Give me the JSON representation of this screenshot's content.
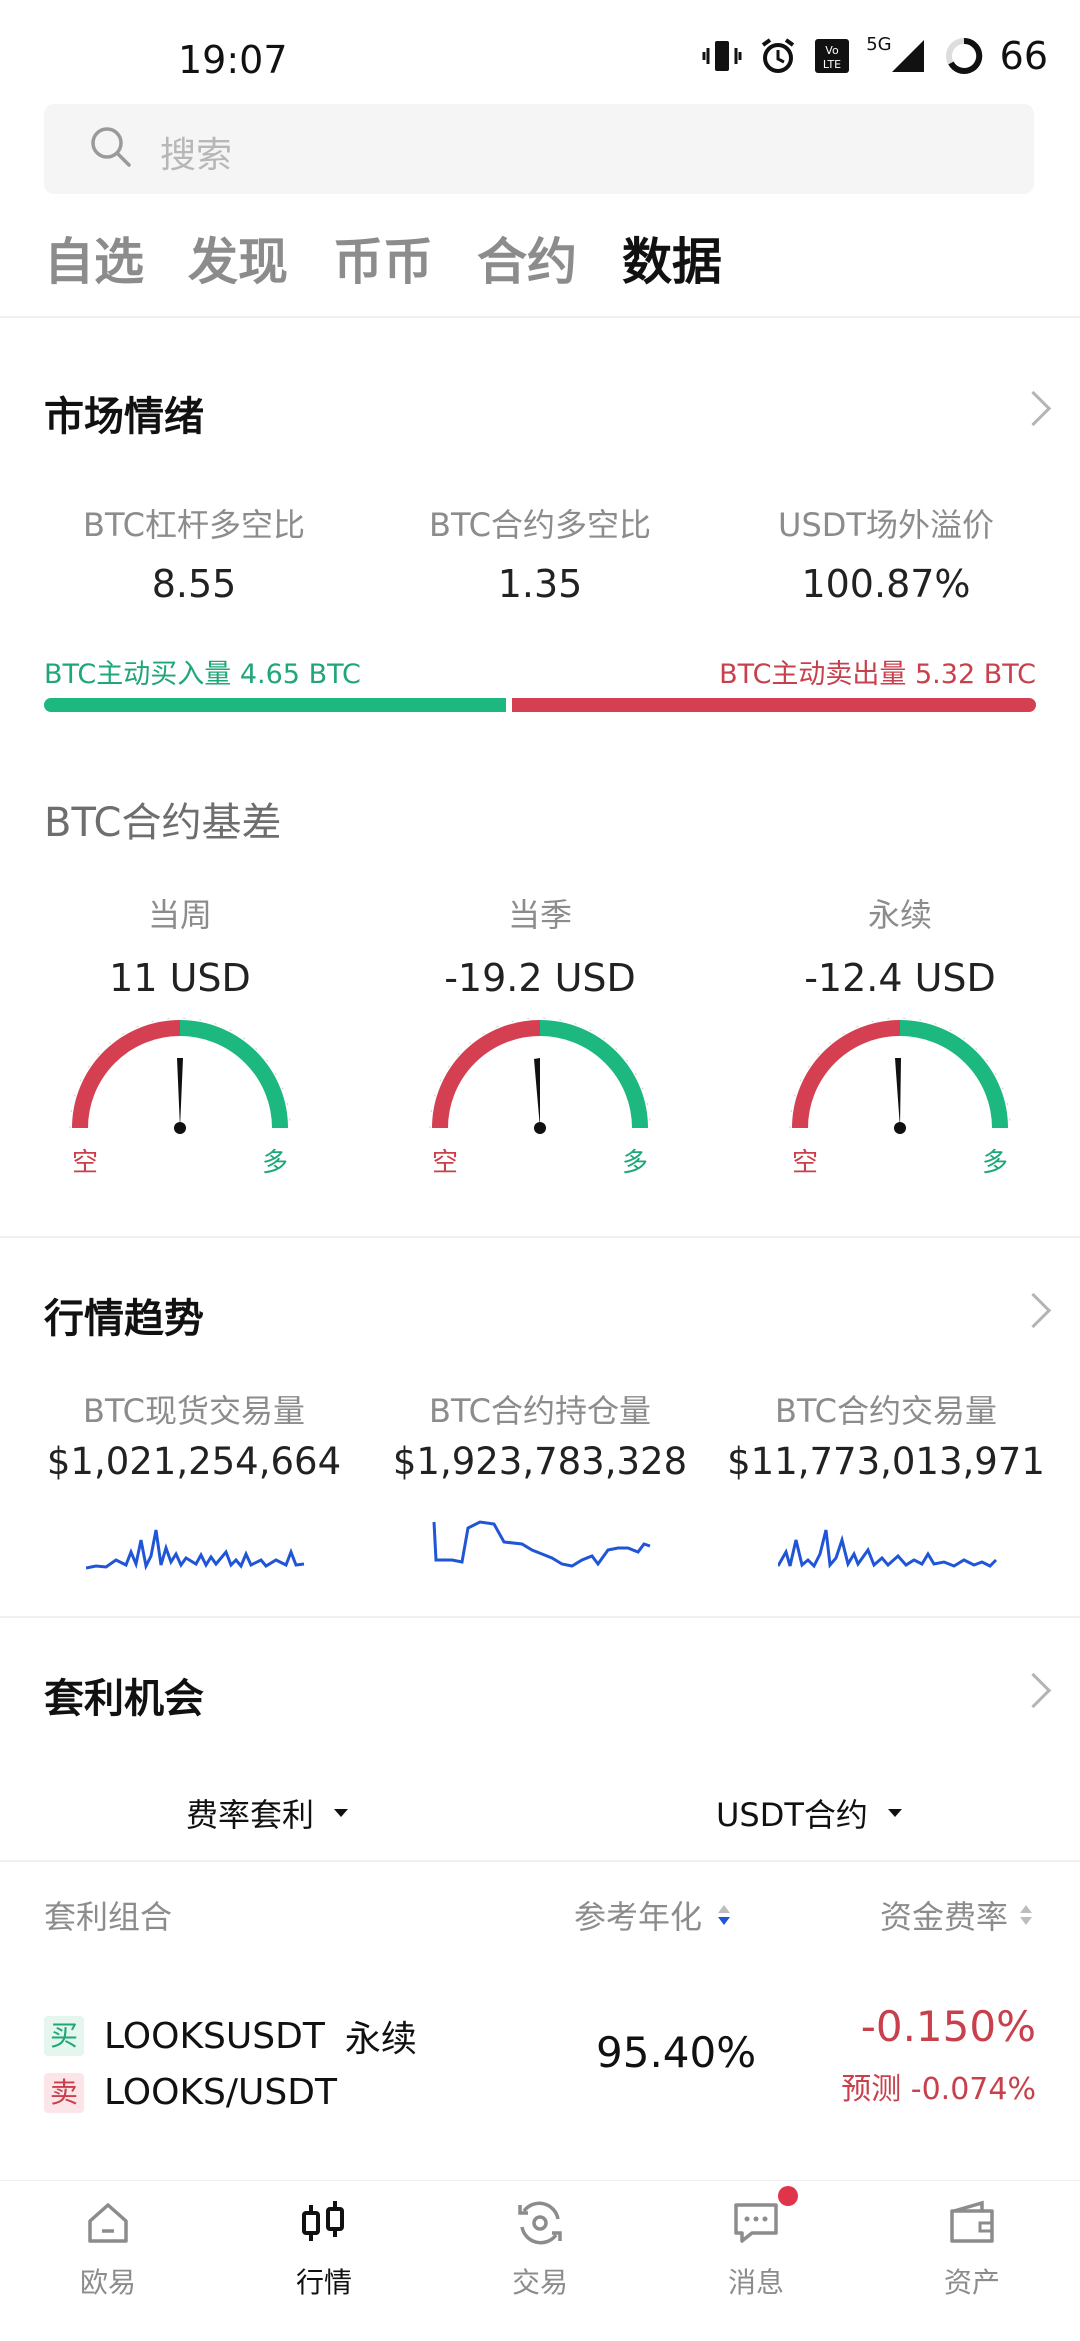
{
  "status": {
    "time": "19:07",
    "battery": "66",
    "network": "5G"
  },
  "search": {
    "placeholder": "搜索"
  },
  "tabs": [
    "自选",
    "发现",
    "币币",
    "合约",
    "数据"
  ],
  "sentiment": {
    "title": "市场情绪",
    "stats": [
      {
        "label": "BTC杠杆多空比",
        "value": "8.55"
      },
      {
        "label": "BTC合约多空比",
        "value": "1.35"
      },
      {
        "label": "USDT场外溢价",
        "value": "100.87%"
      }
    ],
    "buy_volume": "BTC主动买入量 4.65 BTC",
    "sell_volume": "BTC主动卖出量 5.32 BTC",
    "buy_fraction": 0.466
  },
  "basis": {
    "title": "BTC合约基差",
    "gauges": [
      {
        "label": "当周",
        "value": "11 USD",
        "short": "空",
        "long": "多"
      },
      {
        "label": "当季",
        "value": "-19.2 USD",
        "short": "空",
        "long": "多"
      },
      {
        "label": "永续",
        "value": "-12.4 USD",
        "short": "空",
        "long": "多"
      }
    ]
  },
  "trend": {
    "title": "行情趋势",
    "items": [
      {
        "label": "BTC现货交易量",
        "value": "$1,021,254,664"
      },
      {
        "label": "BTC合约持仓量",
        "value": "$1,923,783,328"
      },
      {
        "label": "BTC合约交易量",
        "value": "$11,773,013,971"
      }
    ]
  },
  "arbitrage": {
    "title": "套利机会",
    "filters": {
      "type": "费率套利",
      "market": "USDT合约"
    },
    "headers": {
      "combo": "套利组合",
      "annual": "参考年化",
      "funding": "资金费率"
    },
    "row": {
      "buy_tag": "买",
      "sell_tag": "卖",
      "buy_pair": "LOOKSUSDT",
      "buy_type": "永续",
      "sell_pair": "LOOKS/USDT",
      "annual": "95.40%",
      "funding": "-0.150%",
      "forecast": "预测 -0.074%"
    }
  },
  "nav": [
    {
      "label": "欧易",
      "icon": "home-icon"
    },
    {
      "label": "行情",
      "icon": "candlestick-icon"
    },
    {
      "label": "交易",
      "icon": "trade-icon"
    },
    {
      "label": "消息",
      "icon": "message-icon"
    },
    {
      "label": "资产",
      "icon": "wallet-icon"
    }
  ],
  "colors": {
    "green": "#1cb87f",
    "red": "#d43f52",
    "spark": "#1f55d6"
  }
}
